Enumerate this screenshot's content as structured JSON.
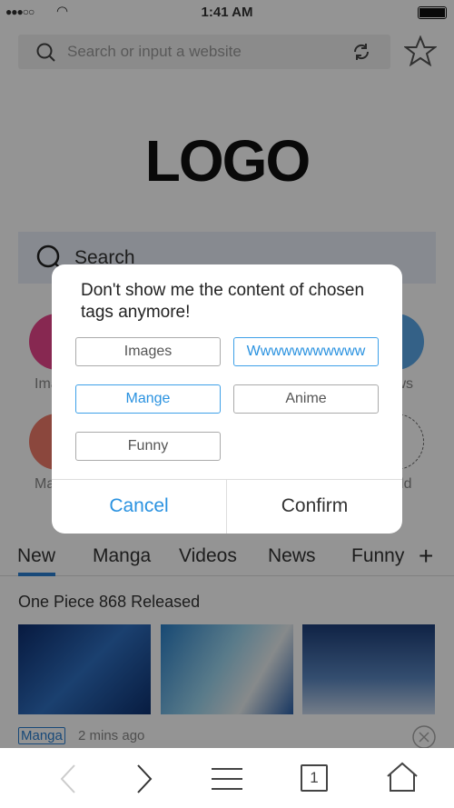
{
  "status_bar": {
    "time": "1:41 AM"
  },
  "top_search": {
    "placeholder": "Search or input a website"
  },
  "logo": "LOGO",
  "main_search": {
    "placeholder": "Search"
  },
  "quick_access": [
    {
      "label": "Images",
      "color": "#e8468c"
    },
    {
      "label": "News",
      "color": "#5aa7e8"
    },
    {
      "label": "Manga",
      "color": "#f07a6a"
    },
    {
      "label": "Add"
    }
  ],
  "tabs": [
    {
      "label": "New",
      "active": true
    },
    {
      "label": "Manga"
    },
    {
      "label": "Videos"
    },
    {
      "label": "News"
    },
    {
      "label": "Funny"
    }
  ],
  "feed": {
    "title": "One Piece 868 Released",
    "tag": "Manga",
    "time": "2 mins ago"
  },
  "dialog": {
    "message": "Don't show me the content of chosen tags anymore!",
    "tags": [
      {
        "label": "Images",
        "selected": false
      },
      {
        "label": "Wwwwwwwwwww",
        "selected": true
      },
      {
        "label": "Mange",
        "selected": true
      },
      {
        "label": "Anime",
        "selected": false
      },
      {
        "label": "Funny",
        "selected": false
      }
    ],
    "cancel": "Cancel",
    "confirm": "Confirm"
  },
  "toolbar": {
    "tab_count": "1"
  },
  "colors": {
    "accent": "#2a92e0",
    "overlay": "rgba(0,0,0,0.42)"
  }
}
